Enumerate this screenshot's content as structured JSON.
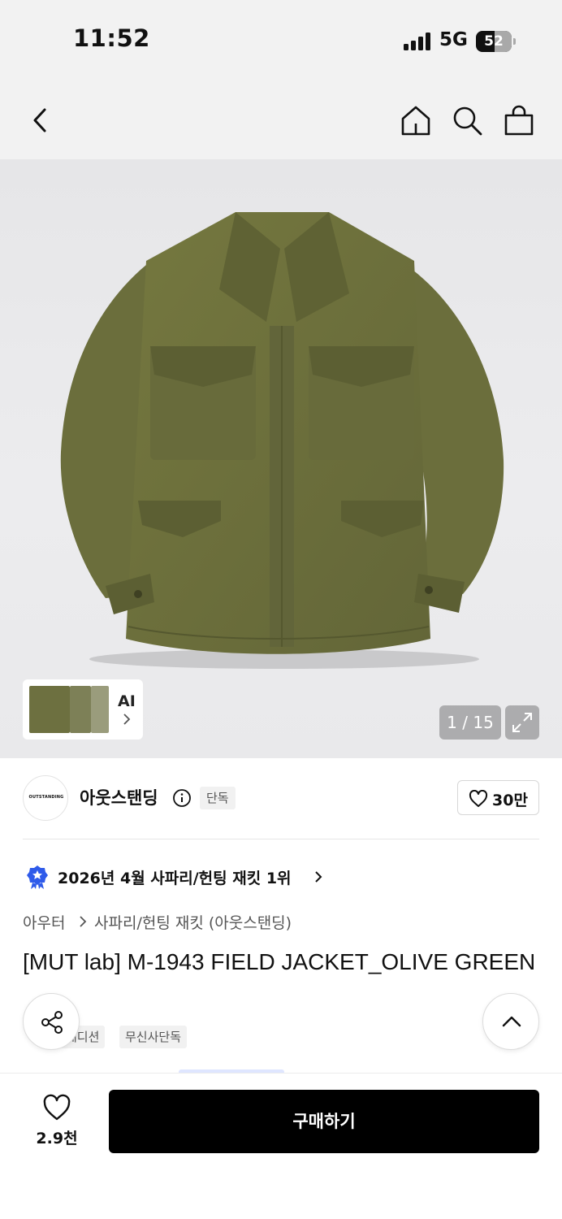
{
  "status_bar": {
    "time": "11:52",
    "network": "5G",
    "battery": "52",
    "battery_level": 0.52
  },
  "nav": {
    "icons": [
      "back-icon",
      "home-icon",
      "search-icon",
      "shopping-bag-icon"
    ]
  },
  "gallery": {
    "thumbnail_label": "AI",
    "counter": "1 / 15",
    "colors": {
      "jacket": "#6d7040",
      "background": "#e8e8ea"
    }
  },
  "brand": {
    "logo_text": "OUTSTANDING",
    "name": "아웃스탠딩",
    "badge": "단독",
    "likes": "30만"
  },
  "ranking": {
    "text": "2026년 4월 사파리/헌팅 재킷 1위"
  },
  "category": {
    "level1": "아우터",
    "level2": "사파리/헌팅 재킷 (아웃스탠딩)"
  },
  "product": {
    "title": "[MUT lab] M-1943 FIELD JACKET_OLIVE GREEN"
  },
  "tags": [
    "에디션",
    "무신사단독"
  ],
  "bottom_bar": {
    "wishlist_count": "2.9천",
    "buy_label": "구매하기"
  },
  "colors": {
    "primary": "#000000",
    "rank_badge": "#2f5bea"
  }
}
